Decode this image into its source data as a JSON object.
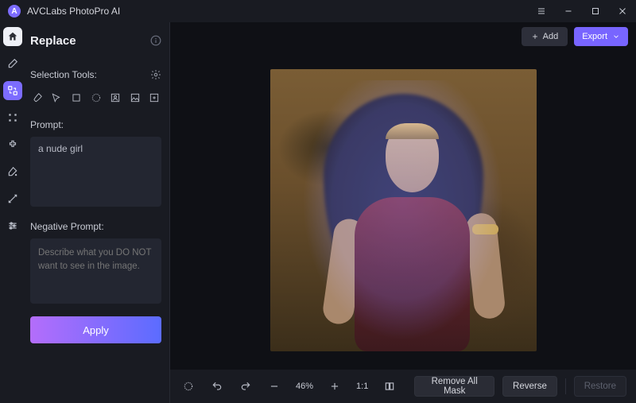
{
  "app": {
    "title": "AVCLabs PhotoPro AI",
    "logo_letter": "A"
  },
  "header": {
    "feature": "Replace"
  },
  "selection": {
    "label": "Selection Tools:"
  },
  "prompt": {
    "label": "Prompt:",
    "value": "a nude girl"
  },
  "neg_prompt": {
    "label": "Negative Prompt:",
    "placeholder": "Describe what you DO NOT want to see in the image."
  },
  "actions": {
    "apply": "Apply",
    "add": "Add",
    "export": "Export"
  },
  "viewer": {
    "zoom": "46%",
    "one_to_one": "1:1"
  },
  "bottom": {
    "remove_mask": "Remove All Mask",
    "reverse": "Reverse",
    "restore": "Restore"
  },
  "colors": {
    "accent": "#7865ff",
    "grad_a": "#b46dfb",
    "grad_b": "#5b6cff"
  }
}
